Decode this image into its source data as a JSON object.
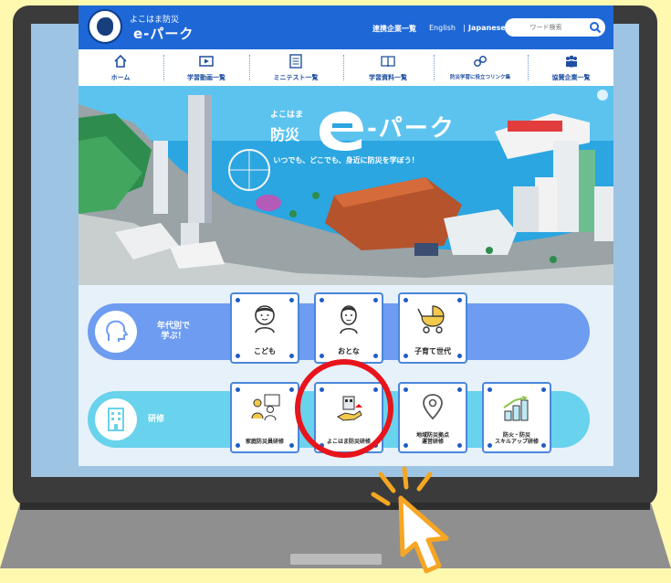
{
  "header": {
    "site_name_small": "よこはま防災",
    "site_name_big": "e-パーク",
    "partners_link": "連携企業一覧",
    "english_link": "English",
    "separator": "|",
    "japanese_link": "Japanese",
    "search_placeholder": "ワード検索"
  },
  "nav": {
    "items": [
      {
        "label": "ホーム",
        "icon": "home-icon"
      },
      {
        "label": "学習動画一覧",
        "icon": "video-icon"
      },
      {
        "label": "ミニテスト一覧",
        "icon": "test-icon"
      },
      {
        "label": "学習資料一覧",
        "icon": "book-icon"
      },
      {
        "label": "防災学習に役立つリンク集",
        "icon": "link-icon"
      },
      {
        "label": "協賛企業一覧",
        "icon": "people-icon"
      }
    ]
  },
  "hero": {
    "title_small": "よこはま",
    "title_big": "防災",
    "title_rest": "-パーク",
    "tagline": "いつでも、どこでも、身近に防災を学ぼう！"
  },
  "sections": {
    "age": {
      "label": "年代別で\n学ぶ！",
      "cards": [
        {
          "label": "こども",
          "icon": "child-icon"
        },
        {
          "label": "おとな",
          "icon": "adult-icon"
        },
        {
          "label": "子育て世代",
          "icon": "stroller-icon"
        }
      ]
    },
    "training": {
      "label": "研修",
      "cards": [
        {
          "label": "家庭防災員研修",
          "icon": "family-training-icon"
        },
        {
          "label": "よこはま防災研修",
          "icon": "yokohama-training-icon"
        },
        {
          "label": "地域防災拠点\n運営研修",
          "icon": "location-pin-icon"
        },
        {
          "label": "防火・防災\nスキルアップ研修",
          "icon": "chart-growth-icon"
        }
      ]
    }
  },
  "colors": {
    "header_blue": "#1E67D6",
    "age_band": "#6E9CF0",
    "training_band": "#69D2EC",
    "highlight_red": "#E8141B",
    "cursor_orange": "#F6A623",
    "background_yellow": "#FFF9B0"
  }
}
